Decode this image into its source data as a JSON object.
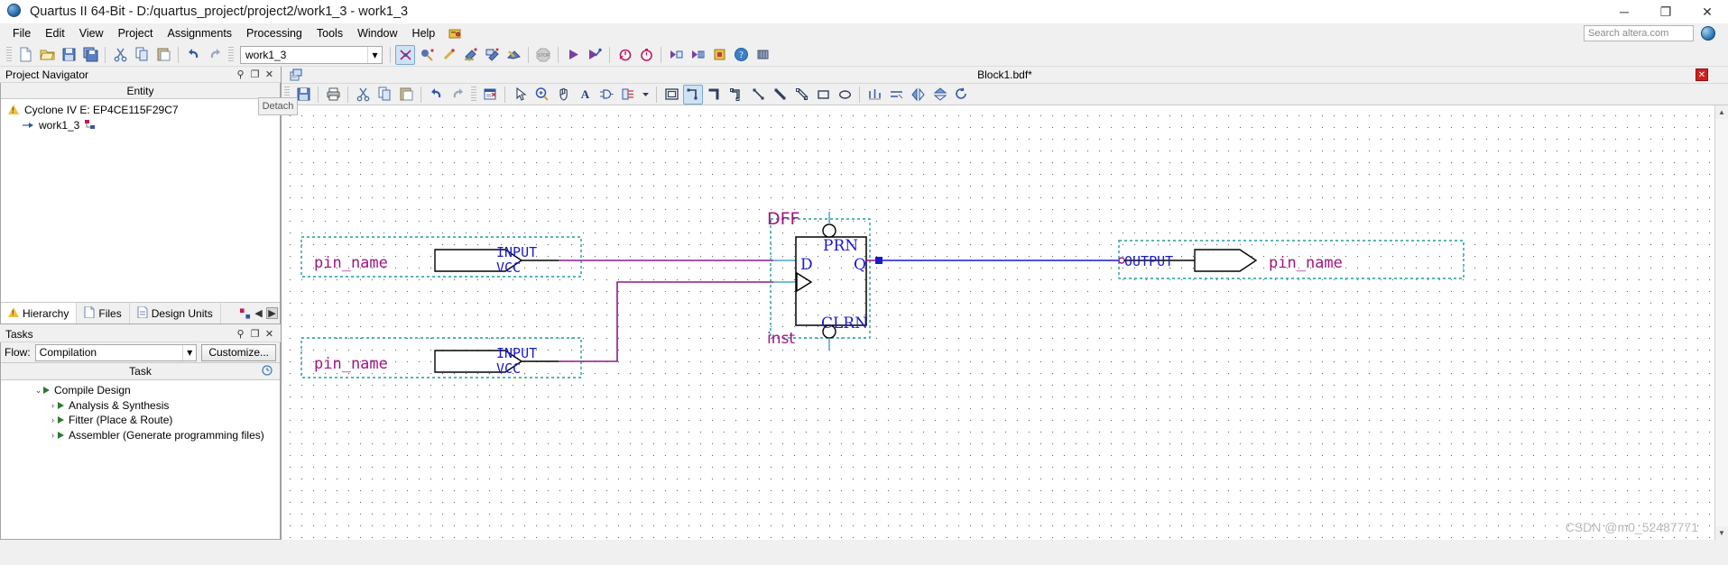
{
  "window": {
    "title": "Quartus II 64-Bit - D:/quartus_project/project2/work1_3 - work1_3",
    "icon": "quartus-globe-icon",
    "minimize": "─",
    "maximize": "❐",
    "close": "✕"
  },
  "menu": {
    "items": [
      "File",
      "Edit",
      "View",
      "Project",
      "Assignments",
      "Processing",
      "Tools",
      "Window",
      "Help"
    ],
    "search_placeholder": "Search altera.com",
    "search_value": ""
  },
  "toolbar": {
    "project_combo": "work1_3",
    "buttons": [
      "new-file-icon",
      "open-file-icon",
      "save-file-icon",
      "save-all-icon",
      "cut-icon",
      "copy-icon",
      "paste-icon",
      "undo-icon",
      "redo-icon"
    ],
    "compile_buttons": [
      "start-compilation-icon",
      "analysis-elaboration-icon",
      "analysis-synthesis-icon",
      "fitter-icon",
      "assembler-icon",
      "timing-analyzer-icon",
      "stop-icon",
      "start-icon",
      "programmer-icon",
      "timing-analyzer-tool-icon",
      "timequest-icon",
      "rtl-viewer-icon",
      "technology-viewer-icon",
      "pin-planner-icon",
      "help-icon",
      "chip-planner-icon"
    ]
  },
  "project_navigator": {
    "title": "Project Navigator",
    "panel_buttons": [
      "pin-icon",
      "restore-icon",
      "close-icon"
    ],
    "column_header": "Entity",
    "tree": [
      {
        "icon": "warning-triangle-icon",
        "label": "Cyclone IV E: EP4CE115F29C7",
        "indent": 0
      },
      {
        "icon": "entity-icon",
        "label": "work1_3",
        "indent": 1,
        "badge": "hierarchy-badge-icon"
      }
    ],
    "tabs": [
      {
        "label": "Hierarchy",
        "icon": "hierarchy-icon",
        "selected": true
      },
      {
        "label": "Files",
        "icon": "files-icon",
        "selected": false
      },
      {
        "label": "Design Units",
        "icon": "design-units-icon",
        "selected": false
      }
    ],
    "tab_overflow_icons": [
      "ip-catalog-icon",
      "scroll-left-icon",
      "scroll-right-icon"
    ]
  },
  "tasks": {
    "title": "Tasks",
    "panel_buttons": [
      "pin-icon",
      "restore-icon",
      "close-icon"
    ],
    "flow_label": "Flow:",
    "flow_value": "Compilation",
    "customize_label": "Customize...",
    "column_header": "Task",
    "time_column_icon": "clock-icon",
    "rows": [
      {
        "label": "Compile Design",
        "indent": 0,
        "expander": "⌄",
        "expanded": true
      },
      {
        "label": "Analysis & Synthesis",
        "indent": 1,
        "expander": "›",
        "expanded": false
      },
      {
        "label": "Fitter (Place & Route)",
        "indent": 1,
        "expander": "›",
        "expanded": false
      },
      {
        "label": "Assembler (Generate programming files)",
        "indent": 1,
        "expander": "›",
        "expanded": false
      }
    ]
  },
  "editor": {
    "detach_icon": "detach-window-icon",
    "detach_tooltip": "Detach",
    "document_title": "Block1.bdf*",
    "close_tab": "✕",
    "toolbar_icons": [
      "save-icon",
      "print-icon",
      "cut-icon",
      "copy-icon",
      "paste-icon",
      "undo-icon",
      "redo-icon",
      "find-replace-icon",
      "select-arrow-icon",
      "zoom-icon",
      "hand-pan-icon",
      "text-tool-icon",
      "symbol-tool-icon",
      "pin-tool-icon",
      "tool-dropdown-icon",
      "block-tool-icon",
      "orthogonal-node-tool-icon",
      "orthogonal-bus-tool-icon",
      "orthogonal-conduit-tool-icon",
      "diagonal-node-tool-icon",
      "diagonal-bus-tool-icon",
      "diagonal-conduit-tool-icon",
      "rectangle-tool-icon",
      "oval-tool-icon",
      "rubber-band-icon",
      "partial-line-select-icon",
      "flip-horizontal-icon",
      "flip-vertical-icon",
      "rotate-icon"
    ],
    "active_tool": "orthogonal-node-tool-icon",
    "scrollbar": {
      "up": "▲",
      "down": "▼"
    }
  },
  "schematic": {
    "input_pin_1": {
      "name": "pin_name",
      "type": "INPUT",
      "default": "VCC"
    },
    "input_pin_2": {
      "name": "pin_name",
      "type": "INPUT",
      "default": "VCC"
    },
    "output_pin": {
      "type": "OUTPUT",
      "name": "pin_name"
    },
    "dff": {
      "label": "DFF",
      "instance": "inst",
      "port_d": "D",
      "port_q": "Q",
      "port_prn": "PRN",
      "port_clrn": "CLRN"
    },
    "colors": {
      "pin_text": "#a0157d",
      "port_text": "#1a1acc",
      "wire": "#1a1acc",
      "pin_wire": "#8b1a8b",
      "selection": "#1f9e9e",
      "symbol_outline": "#000000"
    }
  },
  "watermark": "CSDN @m0_52487771"
}
